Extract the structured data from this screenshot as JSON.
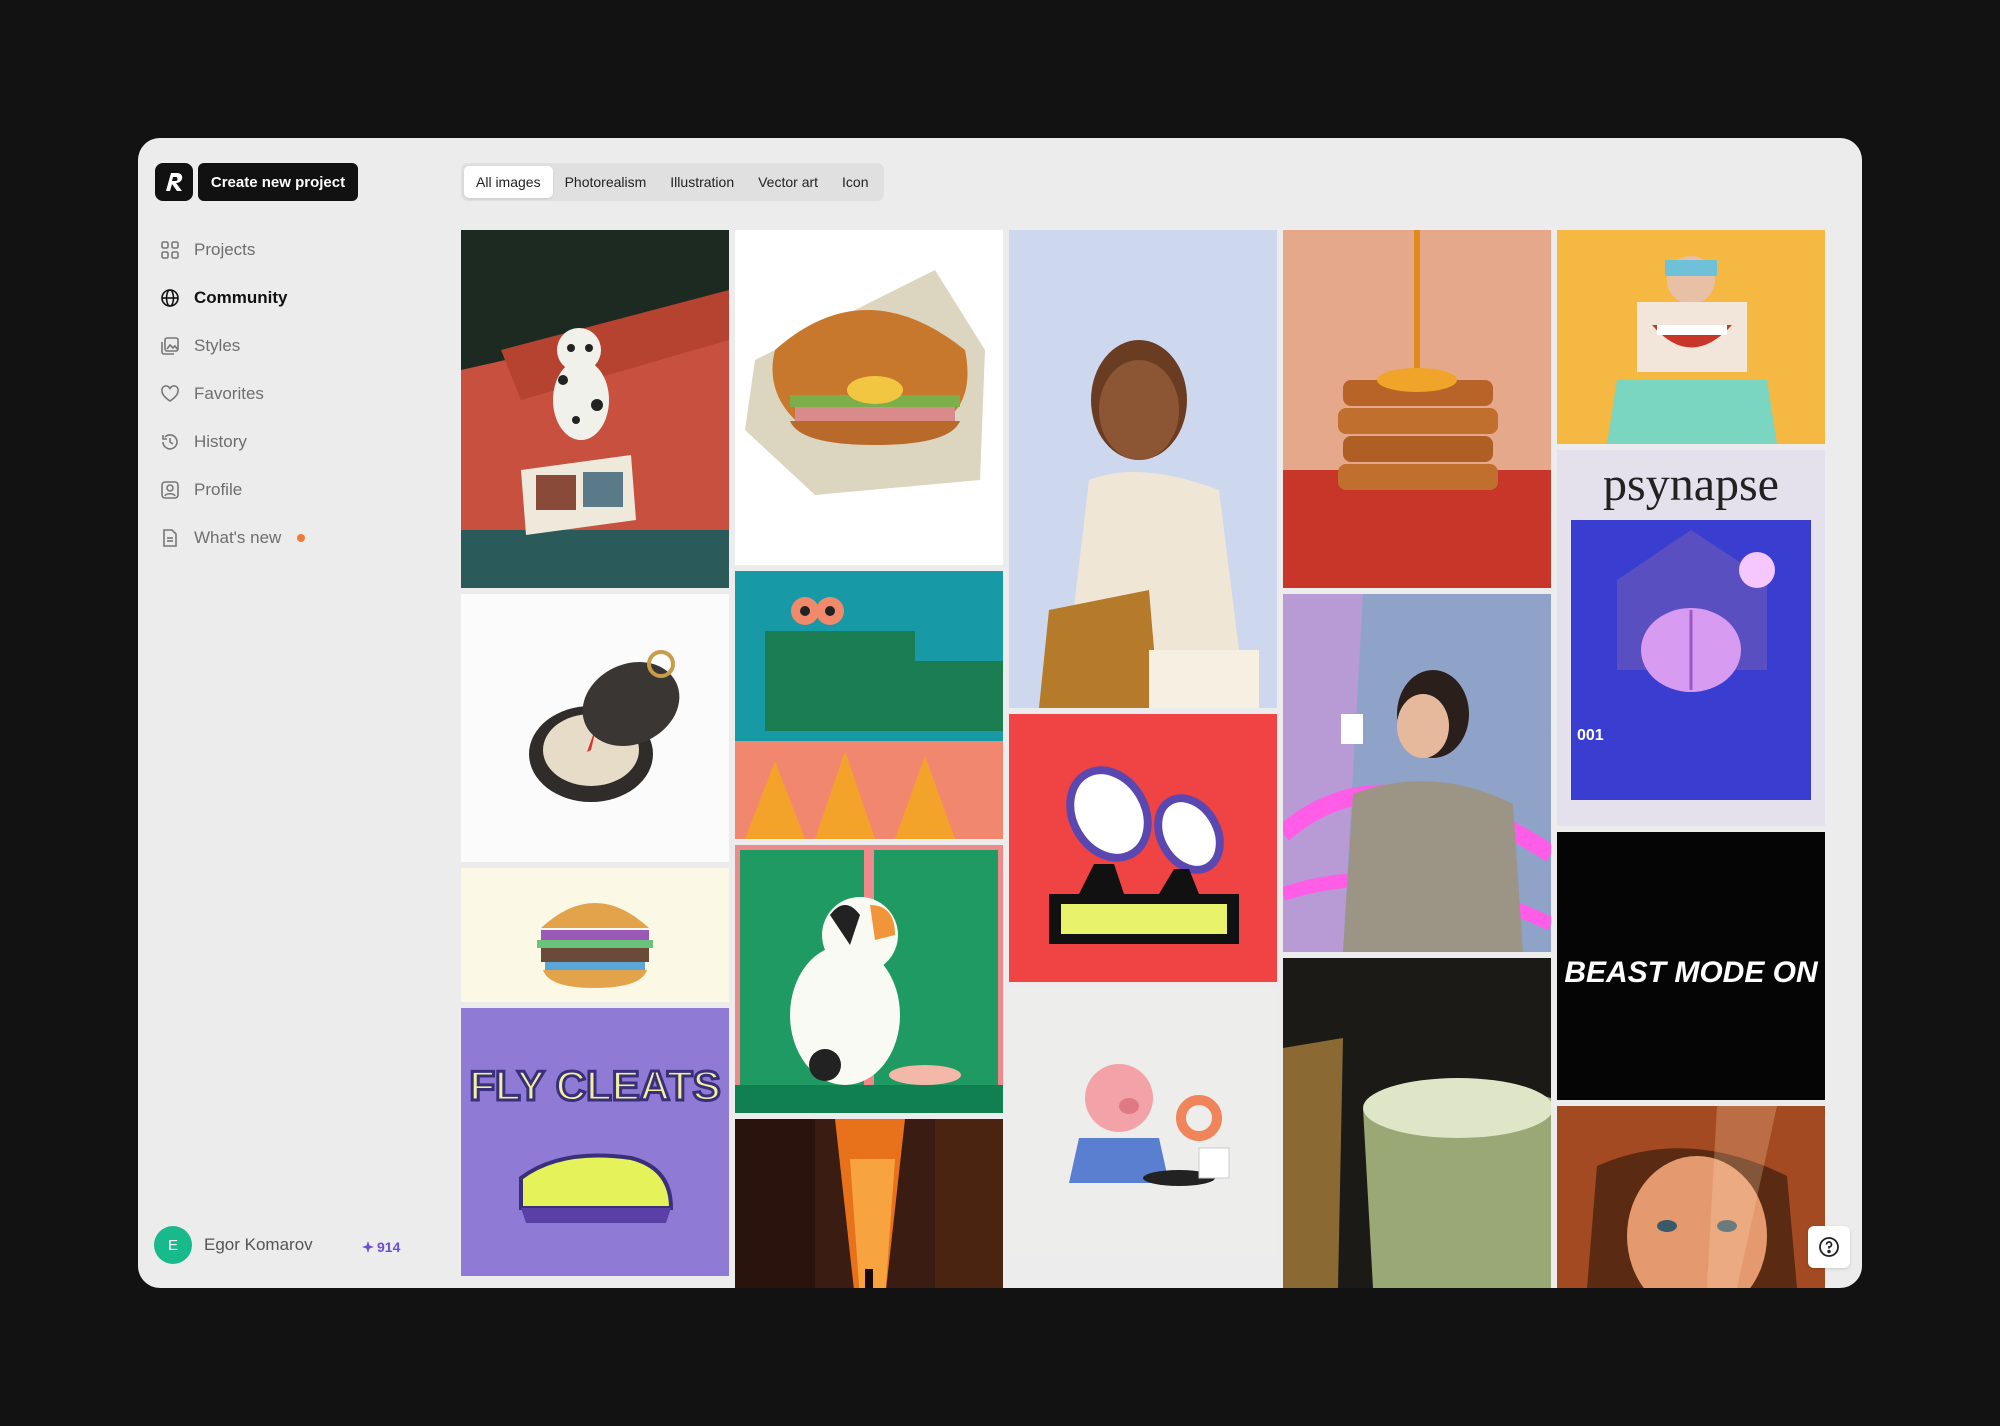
{
  "sidebar": {
    "create_label": "Create new project",
    "items": [
      {
        "label": "Projects",
        "icon": "grid-icon",
        "active": false
      },
      {
        "label": "Community",
        "icon": "globe-icon",
        "active": true
      },
      {
        "label": "Styles",
        "icon": "image-stack-icon",
        "active": false
      },
      {
        "label": "Favorites",
        "icon": "heart-icon",
        "active": false
      },
      {
        "label": "History",
        "icon": "history-icon",
        "active": false
      },
      {
        "label": "Profile",
        "icon": "user-square-icon",
        "active": false
      },
      {
        "label": "What's new",
        "icon": "document-icon",
        "active": false,
        "badge_color": "#f07a3a"
      }
    ],
    "user": {
      "initial": "E",
      "name": "Egor Komarov",
      "credits": "914",
      "avatar_color": "#18b98b"
    }
  },
  "filters": {
    "tabs": [
      "All images",
      "Photorealism",
      "Illustration",
      "Vector art",
      "Icon"
    ],
    "active": "All images"
  },
  "gallery": {
    "columns": [
      [
        {
          "subject": "dalmatian puppy reading a book on red couch"
        },
        {
          "subject": "open pocket compass"
        },
        {
          "subject": "burger illustration"
        },
        {
          "subject": "Fly Cleats sneaker lettering",
          "text": "FLY CLEATS"
        }
      ],
      [
        {
          "subject": "croissant sandwich illustration"
        },
        {
          "subject": "green crocodile illustration"
        },
        {
          "subject": "calico cat illustration"
        },
        {
          "subject": "orange city alley"
        }
      ],
      [
        {
          "subject": "smiling woman portrait"
        },
        {
          "subject": "satellite dishes vector art"
        },
        {
          "subject": "pig eating donut illustration"
        }
      ],
      [
        {
          "subject": "french toast with syrup"
        },
        {
          "subject": "woman drinking coffee with pink ribbon"
        },
        {
          "subject": "matcha latte with whisk"
        }
      ],
      [
        {
          "subject": "man holding smile photo"
        },
        {
          "subject": "psynapse brain poster",
          "text": "psynapse",
          "number": "001"
        },
        {
          "subject": "Beast Mode On lettering",
          "text": "BEAST MODE ON"
        },
        {
          "subject": "woman portrait in warm light"
        }
      ]
    ]
  },
  "colors": {
    "accent": "#6b4fd8",
    "background": "#121212",
    "panel": "#ececec"
  }
}
